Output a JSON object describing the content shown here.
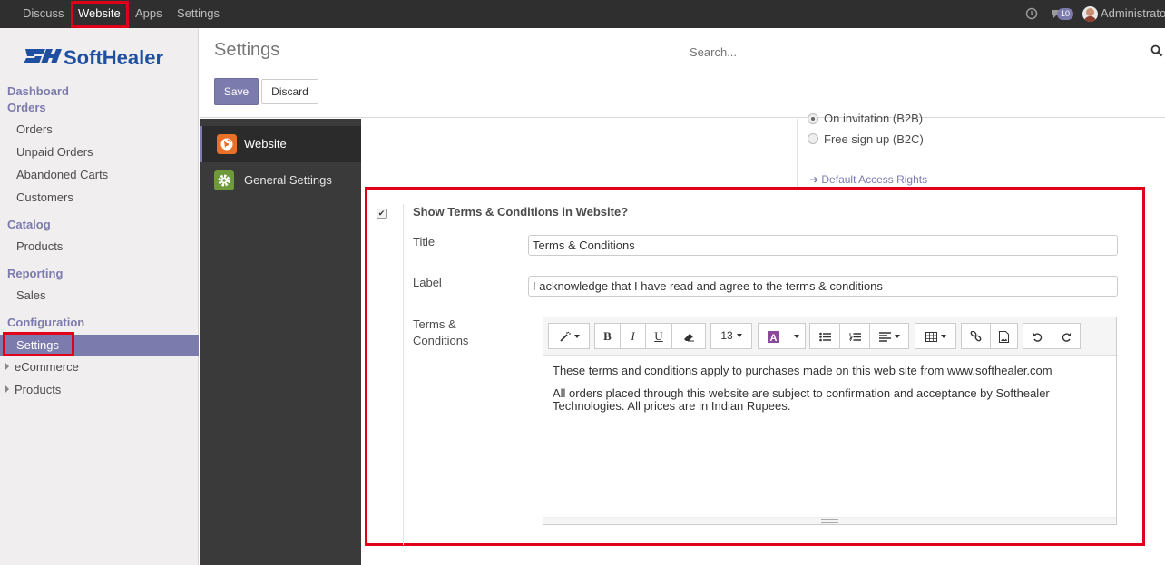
{
  "topbar": {
    "menus": [
      "Discuss",
      "Website",
      "Apps",
      "Settings"
    ],
    "active_menu": "Website",
    "message_count": "10",
    "user_name": "Administrator"
  },
  "sidebar": {
    "brand": "SoftHealer",
    "sections": {
      "dashboard": "Dashboard",
      "orders": "Orders",
      "catalog": "Catalog",
      "reporting": "Reporting",
      "configuration": "Configuration"
    },
    "orders_items": [
      "Orders",
      "Unpaid Orders",
      "Abandoned Carts",
      "Customers"
    ],
    "catalog_items": [
      "Products"
    ],
    "reporting_items": [
      "Sales"
    ],
    "configuration_items": [
      "Settings"
    ],
    "tree_items": [
      "eCommerce",
      "Products"
    ]
  },
  "control_panel": {
    "title": "Settings",
    "search_placeholder": "Search...",
    "save_label": "Save",
    "discard_label": "Discard"
  },
  "settings_nav": {
    "tabs": [
      "Website",
      "General Settings"
    ],
    "selected": "Website"
  },
  "access": {
    "option_b2b": "On invitation (B2B)",
    "option_b2c": "Free sign up (B2C)",
    "link": "Default Access Rights"
  },
  "terms_setting": {
    "checkbox_label": "Show Terms & Conditions in Website?",
    "checked": true,
    "title_label": "Title",
    "title_value": "Terms & Conditions",
    "label_label": "Label",
    "label_value": "I acknowledge that I have read and agree to the terms & conditions",
    "terms_label_line1": "Terms &",
    "terms_label_line2": "Conditions",
    "editor": {
      "font_size": "13",
      "paragraph1": "These terms and conditions apply to purchases made on this web site from www.softhealer.com",
      "paragraph2": "All orders placed through this website are subject to confirmation and acceptance by Softhealer Technologies. All prices are in Indian Rupees."
    }
  },
  "colors": {
    "accent": "#7c7bad",
    "topbar": "#2f2f2f",
    "highlight": "#e0001a",
    "brand_blue": "#1f4fa0"
  }
}
